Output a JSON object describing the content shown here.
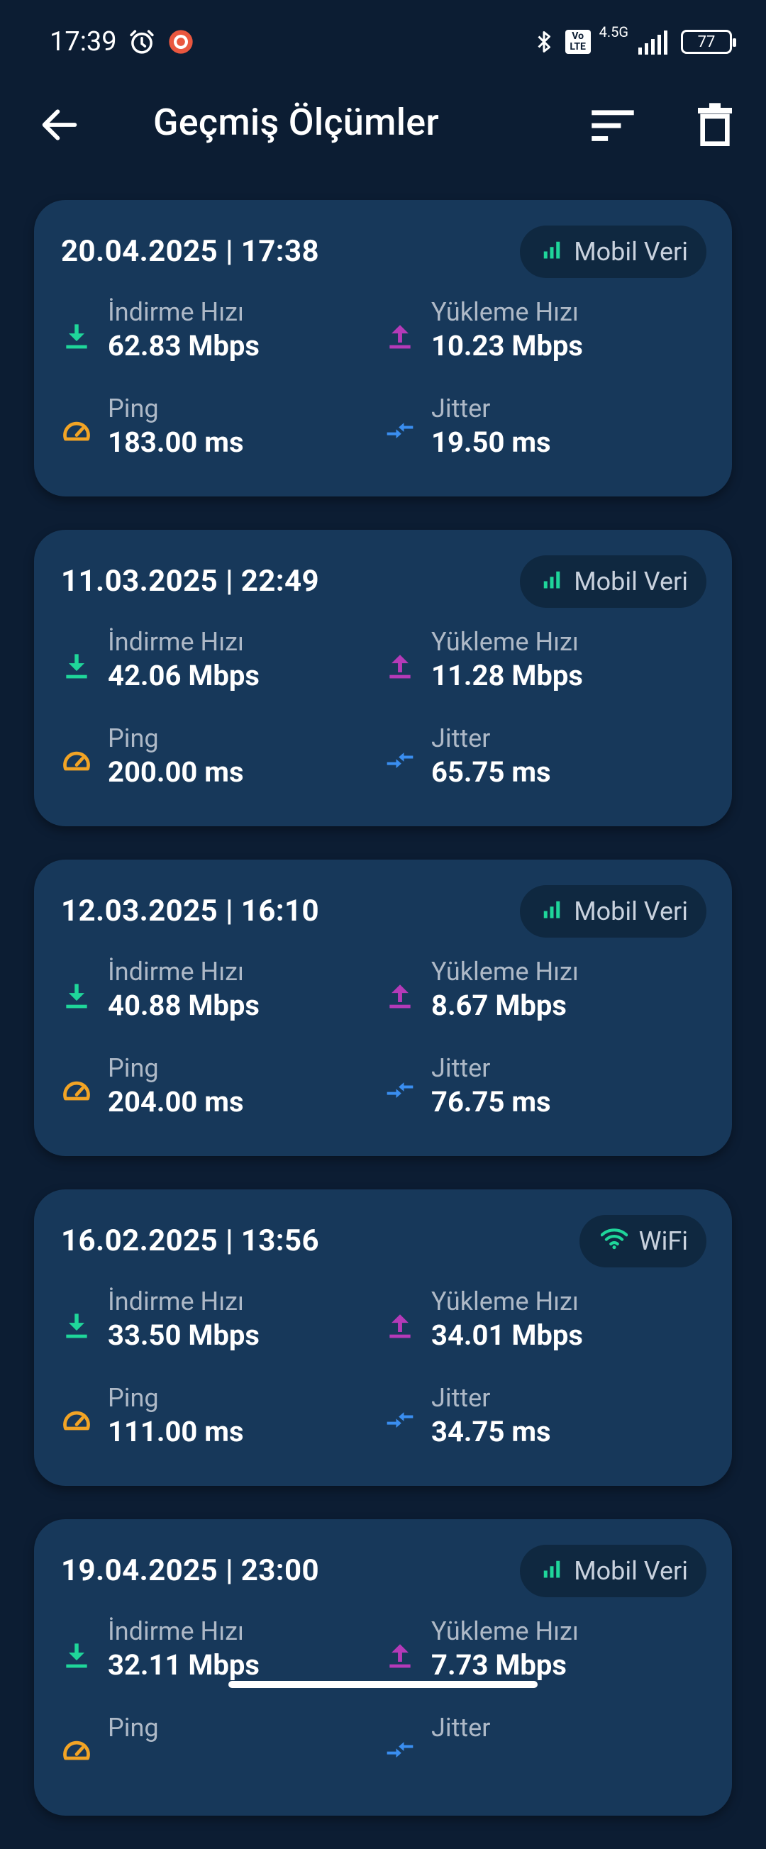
{
  "status_bar": {
    "time": "17:39",
    "network": "4.5G",
    "volte": "Vo LTE",
    "battery": "77",
    "icons": [
      "alarm-icon",
      "recorder-icon",
      "bluetooth-icon",
      "signal-icon",
      "battery-icon"
    ]
  },
  "app_bar": {
    "title": "Geçmiş Ölçümler",
    "icons": [
      "back-arrow-icon",
      "sort-icon",
      "delete-icon"
    ]
  },
  "labels": {
    "download": "İndirme Hızı",
    "upload": "Yükleme Hızı",
    "ping": "Ping",
    "jitter": "Jitter"
  },
  "colors": {
    "download": "#1fd69a",
    "upload": "#b53ab8",
    "ping": "#f2a425",
    "jitter": "#3a8ef0",
    "card": "#17385a",
    "background": "#0c1d33"
  },
  "measurements": [
    {
      "date": "20.04.2025 | 17:38",
      "connection": "Mobil Veri",
      "connection_icon": "cellular-icon",
      "download": "62.83 Mbps",
      "upload": "10.23 Mbps",
      "ping": "183.00 ms",
      "jitter": "19.50 ms"
    },
    {
      "date": "11.03.2025 | 22:49",
      "connection": "Mobil Veri",
      "connection_icon": "cellular-icon",
      "download": "42.06 Mbps",
      "upload": "11.28 Mbps",
      "ping": "200.00 ms",
      "jitter": "65.75 ms"
    },
    {
      "date": "12.03.2025 | 16:10",
      "connection": "Mobil Veri",
      "connection_icon": "cellular-icon",
      "download": "40.88 Mbps",
      "upload": "8.67 Mbps",
      "ping": "204.00 ms",
      "jitter": "76.75 ms"
    },
    {
      "date": "16.02.2025 | 13:56",
      "connection": "WiFi",
      "connection_icon": "wifi-icon",
      "download": "33.50 Mbps",
      "upload": "34.01 Mbps",
      "ping": "111.00 ms",
      "jitter": "34.75 ms"
    },
    {
      "date": "19.04.2025 | 23:00",
      "connection": "Mobil Veri",
      "connection_icon": "cellular-icon",
      "download": "32.11 Mbps",
      "upload": "7.73 Mbps",
      "ping": "",
      "jitter": ""
    }
  ]
}
